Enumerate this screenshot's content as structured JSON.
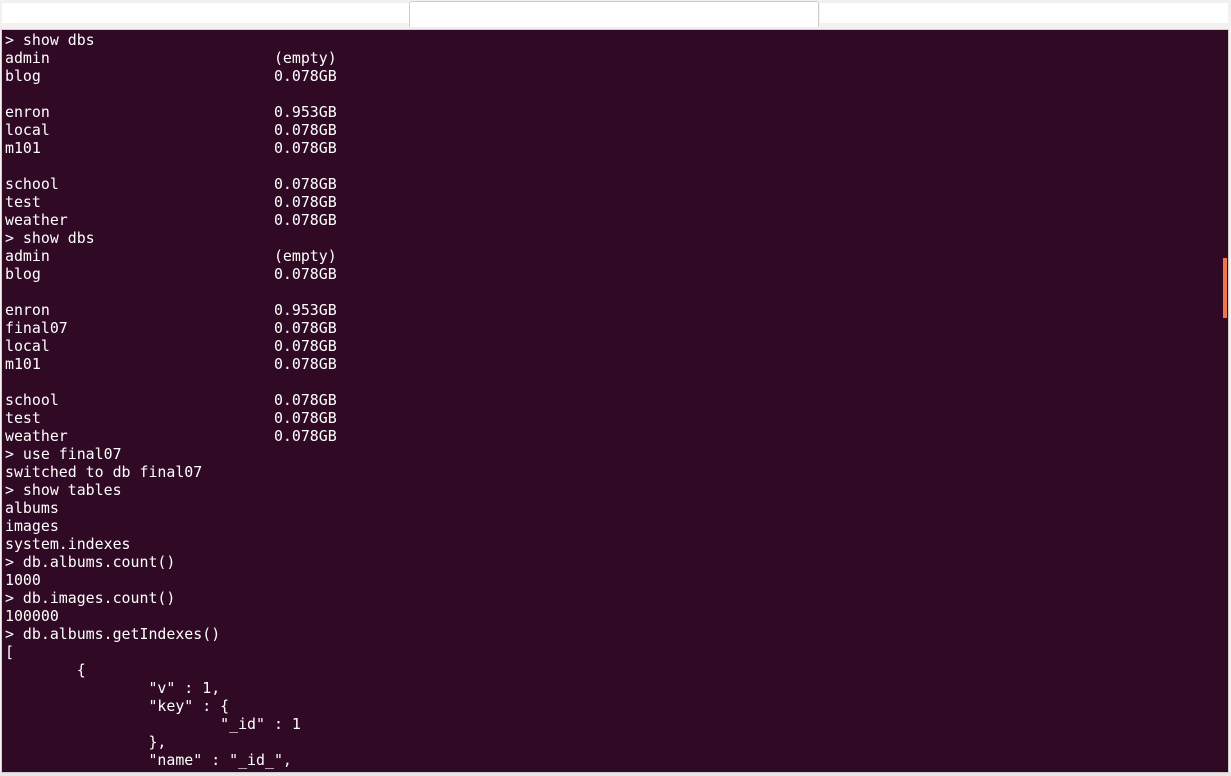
{
  "tabs": [
    {
      "label": ""
    },
    {
      "label": "",
      "active": true
    },
    {
      "label": ""
    }
  ],
  "terminal": {
    "background": "#300a24",
    "foreground": "#ffffff",
    "scrollbar_color": "#f07746",
    "lines": [
      "> show dbs",
      "admin                         (empty)",
      "blog                          0.078GB",
      "",
      "enron                         0.953GB",
      "local                         0.078GB",
      "m101                          0.078GB",
      "",
      "school                        0.078GB",
      "test                          0.078GB",
      "weather                       0.078GB",
      "> show dbs",
      "admin                         (empty)",
      "blog                          0.078GB",
      "",
      "enron                         0.953GB",
      "final07                       0.078GB",
      "local                         0.078GB",
      "m101                          0.078GB",
      "",
      "school                        0.078GB",
      "test                          0.078GB",
      "weather                       0.078GB",
      "> use final07",
      "switched to db final07",
      "> show tables",
      "albums",
      "images",
      "system.indexes",
      "> db.albums.count()",
      "1000",
      "> db.images.count()",
      "100000",
      "> db.albums.getIndexes()",
      "[",
      "        {",
      "                \"v\" : 1,",
      "                \"key\" : {",
      "                        \"_id\" : 1",
      "                },",
      "                \"name\" : \"_id_\","
    ]
  }
}
